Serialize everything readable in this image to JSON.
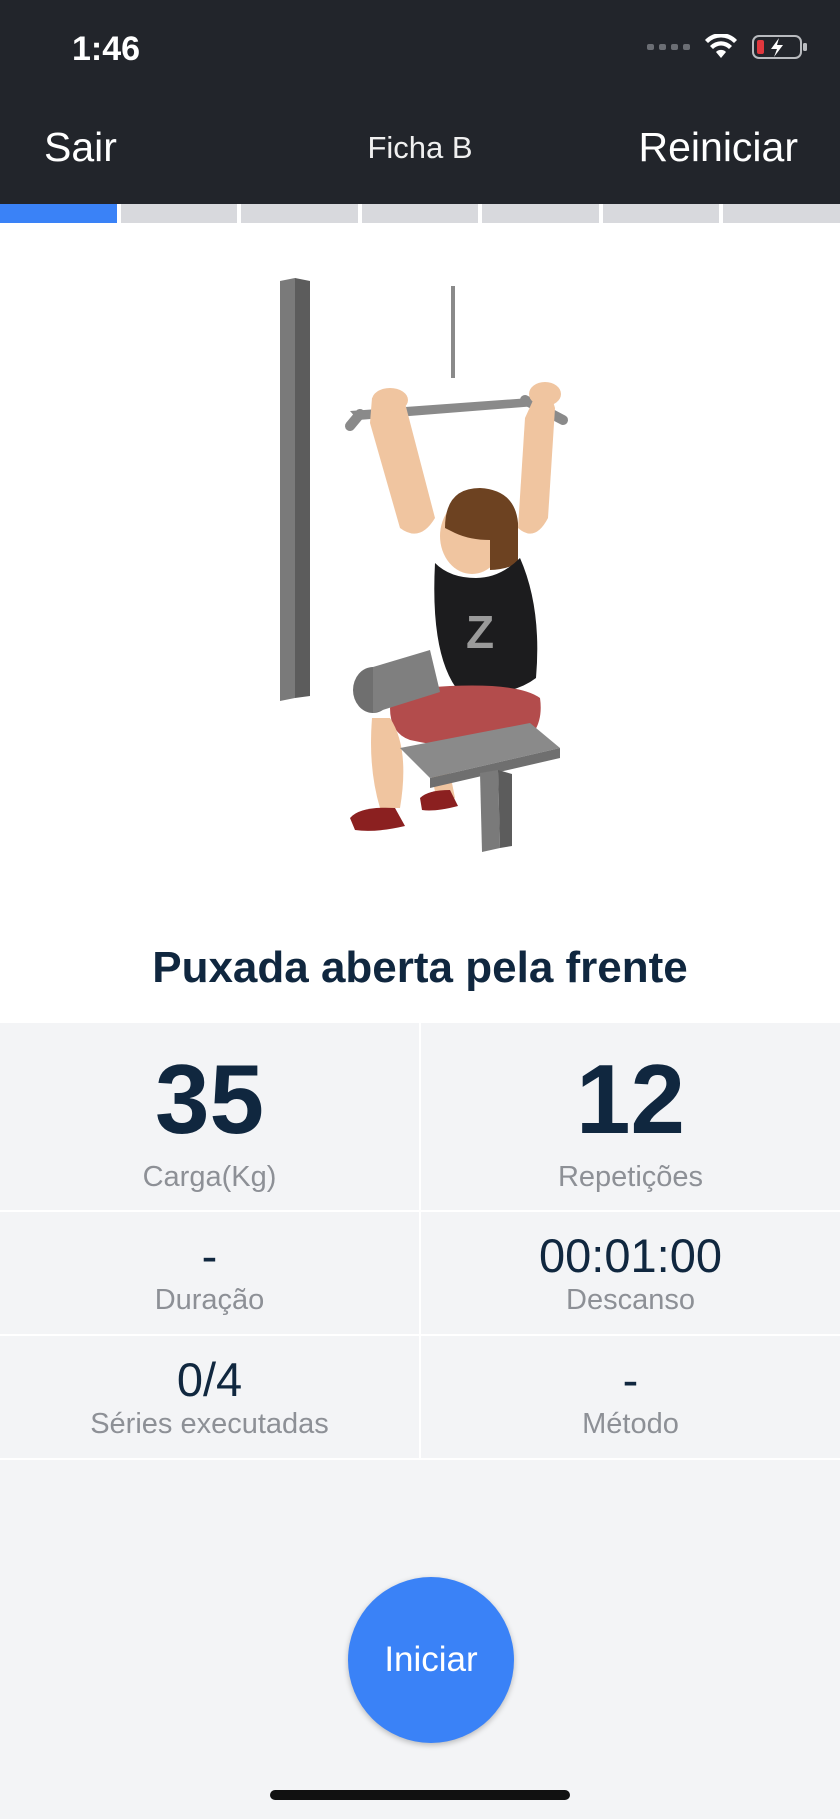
{
  "status_bar": {
    "time": "1:46"
  },
  "nav": {
    "left_label": "Sair",
    "title": "Ficha B",
    "right_label": "Reiniciar"
  },
  "progress": {
    "total_segments": 7,
    "current_segment": 1,
    "active_color": "#3a82f7"
  },
  "exercise": {
    "name": "Puxada aberta pela frente",
    "shirt_letter": "Z"
  },
  "stats": {
    "load": {
      "value": "35",
      "label": "Carga(Kg)"
    },
    "reps": {
      "value": "12",
      "label": "Repetições"
    },
    "duration": {
      "value": "-",
      "label": "Duração"
    },
    "rest": {
      "value": "00:01:00",
      "label": "Descanso"
    },
    "sets": {
      "value": "0/4",
      "label": "Séries executadas"
    },
    "method": {
      "value": "-",
      "label": "Método"
    }
  },
  "actions": {
    "start_label": "Iniciar"
  },
  "colors": {
    "header_bg": "#22252b",
    "title_text": "#10273f",
    "accent": "#3a82f7"
  }
}
